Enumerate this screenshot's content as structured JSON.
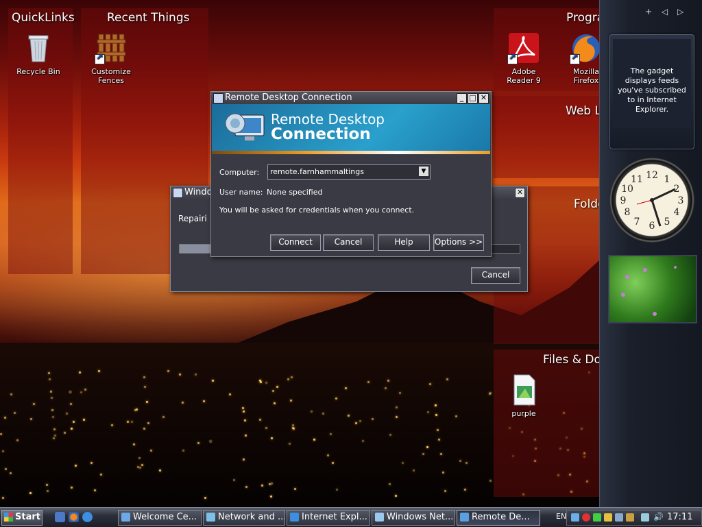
{
  "desktop": {
    "fences": {
      "quicklinks": "QuickLinks",
      "recent": "Recent Things",
      "programs": "Progra",
      "weblinks": "Web L",
      "folders": "Folde",
      "files": "Files & Do"
    },
    "icons": {
      "recycle_bin": "Recycle Bin",
      "customize_fences_1": "Customize",
      "customize_fences_2": "Fences",
      "adobe_1": "Adobe",
      "adobe_2": "Reader 9",
      "firefox_1": "Mozilla",
      "firefox_2": "Firefox",
      "purple": "purple"
    }
  },
  "sidebar": {
    "controls": [
      "+",
      "◁",
      "▷"
    ],
    "feed_text": "The gadget displays feeds you've subscribed to in Internet Explorer."
  },
  "repair_window": {
    "title": "Windo",
    "status": "Repairi",
    "cancel": "Cancel"
  },
  "rdc": {
    "title": "Remote Desktop Connection",
    "banner_line1": "Remote Desktop",
    "banner_line2": "Connection",
    "computer_label": "Computer:",
    "computer_value": "remote.farnhammaltings",
    "username_label": "User name:",
    "username_value": "None specified",
    "info": "You will be asked for credentials when you connect.",
    "buttons": {
      "connect": "Connect",
      "cancel": "Cancel",
      "help": "Help",
      "options": "Options >>"
    }
  },
  "taskbar": {
    "start": "Start",
    "tasks": [
      {
        "label": "Welcome Ce...",
        "icon_color": "#6fa8e8"
      },
      {
        "label": "Network and ...",
        "icon_color": "#7cc0e6"
      },
      {
        "label": "Internet Expl...",
        "icon_color": "#3d8de0"
      },
      {
        "label": "Windows Net...",
        "icon_color": "#9bc6ee"
      },
      {
        "label": "Remote De...",
        "icon_color": "#5aa0e0"
      }
    ],
    "language": "EN",
    "clock": "17:11"
  },
  "colors": {
    "fence_bg": "#780a0a",
    "rdc_banner": "#1a88b8",
    "dialog_bg": "#3a3a44"
  }
}
